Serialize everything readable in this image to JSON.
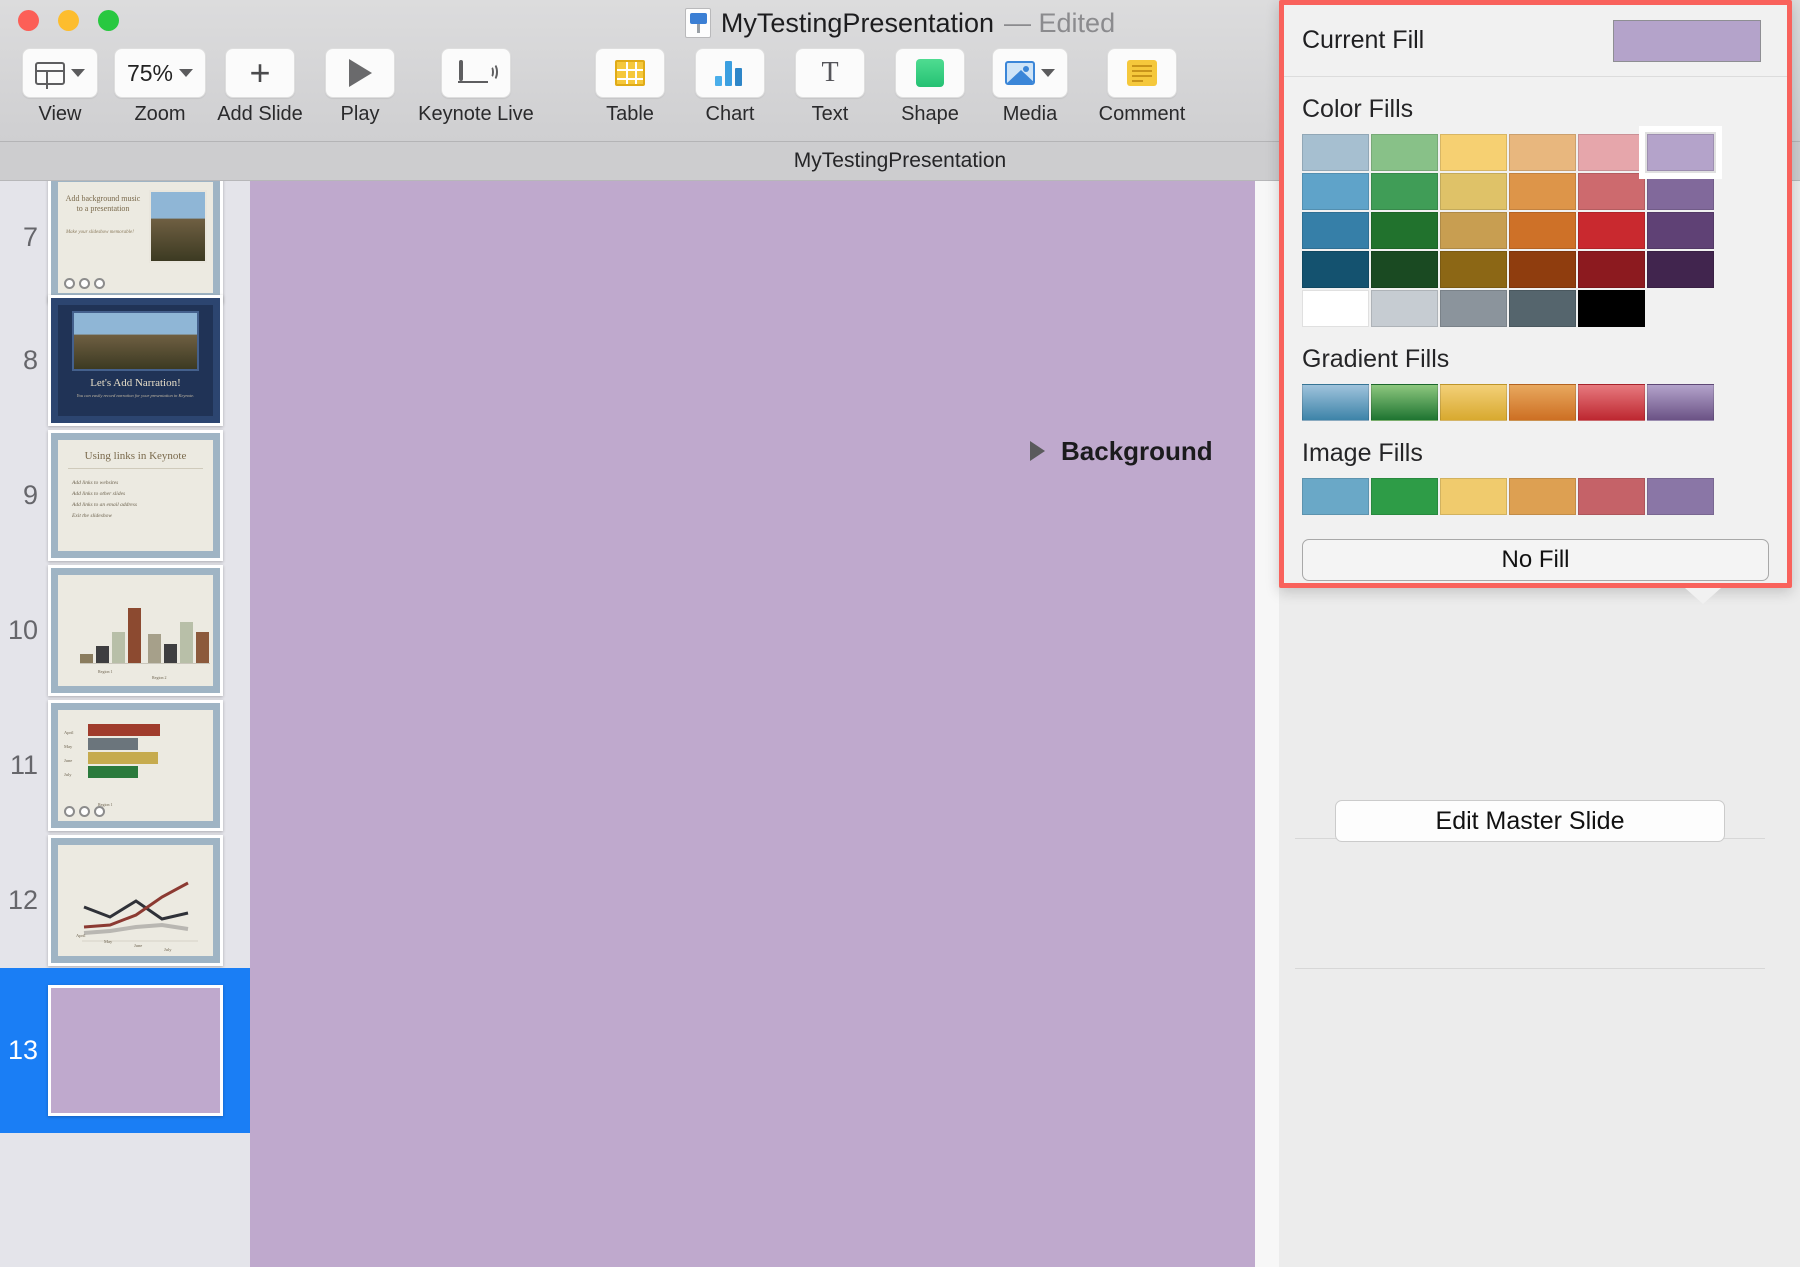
{
  "window": {
    "title": "MyTestingPresentation",
    "title_suffix": "— Edited",
    "subtitle": "MyTestingPresentation",
    "app_icon": "keynote-icon"
  },
  "traffic_lights": [
    {
      "name": "close-button",
      "color": "#fc5f57"
    },
    {
      "name": "minimize-button",
      "color": "#fdbd2e"
    },
    {
      "name": "maximize-button",
      "color": "#28c840"
    }
  ],
  "toolbar": {
    "items": [
      {
        "label": "View",
        "icon": "layout-icon",
        "has_chevron": true
      },
      {
        "label": "Zoom",
        "icon": "zoom-value",
        "value": "75%",
        "has_chevron": true
      },
      {
        "label": "Add Slide",
        "icon": "plus-icon",
        "has_chevron": false
      },
      {
        "label": "Play",
        "icon": "play-icon",
        "has_chevron": false
      },
      {
        "label": "Keynote Live",
        "icon": "keynote-live-icon",
        "has_chevron": false
      },
      {
        "label": "Table",
        "icon": "table-icon",
        "has_chevron": false
      },
      {
        "label": "Chart",
        "icon": "chart-icon",
        "has_chevron": false
      },
      {
        "label": "Text",
        "icon": "text-icon",
        "has_chevron": false
      },
      {
        "label": "Shape",
        "icon": "shape-icon",
        "has_chevron": false
      },
      {
        "label": "Media",
        "icon": "media-icon",
        "has_chevron": true
      },
      {
        "label": "Comment",
        "icon": "comment-icon",
        "has_chevron": false
      }
    ]
  },
  "navigator": {
    "slides": [
      {
        "number": "7",
        "type": "title-photo",
        "title": "Add background music to a presentation",
        "subtitle": "Make your slideshow memorable!",
        "has_dots": true,
        "theme": "light"
      },
      {
        "number": "8",
        "type": "photo-title",
        "title": "Let's Add Narration!",
        "subtitle": "You can easily record narration for your presentation in Keynote.",
        "has_dots": false,
        "theme": "dark"
      },
      {
        "number": "9",
        "type": "bullets",
        "title": "Using links in Keynote",
        "bullets": [
          "Add links to websites",
          "Add links to other slides",
          "Add links to an email address",
          "Exit the slideshow"
        ],
        "has_dots": false,
        "theme": "light"
      },
      {
        "number": "10",
        "type": "column-chart",
        "title": "",
        "has_dots": false,
        "theme": "light"
      },
      {
        "number": "11",
        "type": "bar-chart",
        "title": "",
        "has_dots": true,
        "theme": "light"
      },
      {
        "number": "12",
        "type": "line-chart",
        "title": "",
        "has_dots": false,
        "theme": "light"
      },
      {
        "number": "13",
        "type": "blank",
        "title": "",
        "has_dots": false,
        "theme": "plain",
        "selected": true
      }
    ]
  },
  "canvas": {
    "slide_fill": "#bfa9cd"
  },
  "fill_popover": {
    "highlight_color": "#f9625c",
    "current_fill_label": "Current Fill",
    "current_fill_color": "#b4a3ca",
    "color_fills_label": "Color Fills",
    "gradient_fills_label": "Gradient Fills",
    "image_fills_label": "Image Fills",
    "no_fill_label": "No Fill",
    "selected_swatch_index": 5,
    "color_swatches": [
      [
        "#a6bfd0",
        "#88c188",
        "#f6d072",
        "#e8b77e",
        "#e6a6ab",
        "#b4a3ca"
      ],
      [
        "#5fa3c9",
        "#409d57",
        "#dfc268",
        "#dd9549",
        "#cd6a6e",
        "#81699b"
      ],
      [
        "#367fa8",
        "#21722d",
        "#c89e51",
        "#ce7128",
        "#c9292f",
        "#5f4175"
      ],
      [
        "#14526f",
        "#1a4a22",
        "#8c6715",
        "#8f3d0e",
        "#8c1a1f",
        "#41254e"
      ],
      [
        "#ffffff",
        "#c6ccd2",
        "#8b949c",
        "#55656d",
        "#000000",
        ""
      ]
    ],
    "gradient_swatches": [
      {
        "from": "#9fc3dc",
        "to": "#3d83a8"
      },
      {
        "from": "#8dc77e",
        "to": "#1e7431"
      },
      {
        "from": "#f3d078",
        "to": "#d8a92f"
      },
      {
        "from": "#e8a85e",
        "to": "#cd6f23"
      },
      {
        "from": "#e7797e",
        "to": "#bd2730"
      },
      {
        "from": "#b3a3cb",
        "to": "#6b5285"
      }
    ],
    "image_swatches": [
      "#6aa8c7",
      "#2e9c47",
      "#f0cb6d",
      "#dda052",
      "#c56268",
      "#8a76a6"
    ]
  },
  "inspector": {
    "background_label": "Background",
    "background_color": "#b4a3ca",
    "background_expanded": false,
    "edit_master_label": "Edit Master Slide"
  }
}
